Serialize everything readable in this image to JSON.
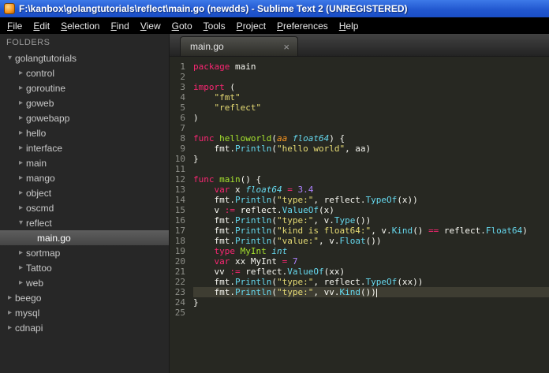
{
  "window": {
    "title": "F:\\kanbox\\golangtutorials\\reflect\\main.go (newdds) - Sublime Text 2 (UNREGISTERED)"
  },
  "menu": {
    "items": [
      "File",
      "Edit",
      "Selection",
      "Find",
      "View",
      "Goto",
      "Tools",
      "Project",
      "Preferences",
      "Help"
    ]
  },
  "sidebar": {
    "header": "FOLDERS",
    "items": [
      {
        "label": "golangtutorials",
        "level": 0,
        "state": "expanded",
        "selected": false
      },
      {
        "label": "control",
        "level": 1,
        "state": "collapsed",
        "selected": false
      },
      {
        "label": "goroutine",
        "level": 1,
        "state": "collapsed",
        "selected": false
      },
      {
        "label": "goweb",
        "level": 1,
        "state": "collapsed",
        "selected": false
      },
      {
        "label": "gowebapp",
        "level": 1,
        "state": "collapsed",
        "selected": false
      },
      {
        "label": "hello",
        "level": 1,
        "state": "collapsed",
        "selected": false
      },
      {
        "label": "interface",
        "level": 1,
        "state": "collapsed",
        "selected": false
      },
      {
        "label": "main",
        "level": 1,
        "state": "collapsed",
        "selected": false
      },
      {
        "label": "mango",
        "level": 1,
        "state": "collapsed",
        "selected": false
      },
      {
        "label": "object",
        "level": 1,
        "state": "collapsed",
        "selected": false
      },
      {
        "label": "oscmd",
        "level": 1,
        "state": "collapsed",
        "selected": false
      },
      {
        "label": "reflect",
        "level": 1,
        "state": "expanded",
        "selected": false
      },
      {
        "label": "main.go",
        "level": 2,
        "state": "file",
        "selected": true
      },
      {
        "label": "sortmap",
        "level": 1,
        "state": "collapsed",
        "selected": false
      },
      {
        "label": "Tattoo",
        "level": 1,
        "state": "collapsed",
        "selected": false
      },
      {
        "label": "web",
        "level": 1,
        "state": "collapsed",
        "selected": false
      },
      {
        "label": "beego",
        "level": 0,
        "state": "collapsed",
        "selected": false
      },
      {
        "label": "mysql",
        "level": 0,
        "state": "collapsed",
        "selected": false
      },
      {
        "label": "cdnapi",
        "level": 0,
        "state": "collapsed",
        "selected": false
      }
    ]
  },
  "tab": {
    "label": "main.go",
    "close_icon": "×"
  },
  "editor": {
    "lines": [
      {
        "n": 1,
        "t": [
          [
            "k",
            "package"
          ],
          [
            "p",
            " main"
          ]
        ]
      },
      {
        "n": 2,
        "t": []
      },
      {
        "n": 3,
        "t": [
          [
            "k",
            "import"
          ],
          [
            "p",
            " ("
          ]
        ]
      },
      {
        "n": 4,
        "t": [
          [
            "p",
            "    "
          ],
          [
            "s",
            "\"fmt\""
          ]
        ]
      },
      {
        "n": 5,
        "t": [
          [
            "p",
            "    "
          ],
          [
            "s",
            "\"reflect\""
          ]
        ]
      },
      {
        "n": 6,
        "t": [
          [
            "p",
            ")"
          ]
        ]
      },
      {
        "n": 7,
        "t": []
      },
      {
        "n": 8,
        "t": [
          [
            "k",
            "func "
          ],
          [
            "f",
            "helloworld"
          ],
          [
            "p",
            "("
          ],
          [
            "a",
            "aa"
          ],
          [
            "p",
            " "
          ],
          [
            "t",
            "float64"
          ],
          [
            "p",
            ") {"
          ]
        ]
      },
      {
        "n": 9,
        "t": [
          [
            "p",
            "    fmt."
          ],
          [
            "c",
            "Println"
          ],
          [
            "p",
            "("
          ],
          [
            "s",
            "\"hello world\""
          ],
          [
            "p",
            ", aa)"
          ]
        ]
      },
      {
        "n": 10,
        "t": [
          [
            "p",
            "}"
          ]
        ]
      },
      {
        "n": 11,
        "t": []
      },
      {
        "n": 12,
        "t": [
          [
            "k",
            "func "
          ],
          [
            "f",
            "main"
          ],
          [
            "p",
            "() {"
          ]
        ]
      },
      {
        "n": 13,
        "t": [
          [
            "p",
            "    "
          ],
          [
            "k",
            "var"
          ],
          [
            "p",
            " x "
          ],
          [
            "t",
            "float64"
          ],
          [
            "p",
            " "
          ],
          [
            "k",
            "="
          ],
          [
            "p",
            " "
          ],
          [
            "n",
            "3.4"
          ]
        ]
      },
      {
        "n": 14,
        "t": [
          [
            "p",
            "    fmt."
          ],
          [
            "c",
            "Println"
          ],
          [
            "p",
            "("
          ],
          [
            "s",
            "\"type:\""
          ],
          [
            "p",
            ", reflect."
          ],
          [
            "c",
            "TypeOf"
          ],
          [
            "p",
            "(x))"
          ]
        ]
      },
      {
        "n": 15,
        "t": [
          [
            "p",
            "    v "
          ],
          [
            "k",
            ":="
          ],
          [
            "p",
            " reflect."
          ],
          [
            "c",
            "ValueOf"
          ],
          [
            "p",
            "(x)"
          ]
        ]
      },
      {
        "n": 16,
        "t": [
          [
            "p",
            "    fmt."
          ],
          [
            "c",
            "Println"
          ],
          [
            "p",
            "("
          ],
          [
            "s",
            "\"type:\""
          ],
          [
            "p",
            ", v."
          ],
          [
            "c",
            "Type"
          ],
          [
            "p",
            "())"
          ]
        ]
      },
      {
        "n": 17,
        "t": [
          [
            "p",
            "    fmt."
          ],
          [
            "c",
            "Println"
          ],
          [
            "p",
            "("
          ],
          [
            "s",
            "\"kind is float64:\""
          ],
          [
            "p",
            ", v."
          ],
          [
            "c",
            "Kind"
          ],
          [
            "p",
            "() "
          ],
          [
            "k",
            "=="
          ],
          [
            "p",
            " reflect."
          ],
          [
            "c",
            "Float64"
          ],
          [
            "p",
            ")"
          ]
        ]
      },
      {
        "n": 18,
        "t": [
          [
            "p",
            "    fmt."
          ],
          [
            "c",
            "Println"
          ],
          [
            "p",
            "("
          ],
          [
            "s",
            "\"value:\""
          ],
          [
            "p",
            ", v."
          ],
          [
            "c",
            "Float"
          ],
          [
            "p",
            "())"
          ]
        ]
      },
      {
        "n": 19,
        "t": [
          [
            "p",
            "    "
          ],
          [
            "k",
            "type"
          ],
          [
            "p",
            " "
          ],
          [
            "f",
            "MyInt"
          ],
          [
            "p",
            " "
          ],
          [
            "t",
            "int"
          ]
        ]
      },
      {
        "n": 20,
        "t": [
          [
            "p",
            "    "
          ],
          [
            "k",
            "var"
          ],
          [
            "p",
            " xx MyInt "
          ],
          [
            "k",
            "="
          ],
          [
            "p",
            " "
          ],
          [
            "n",
            "7"
          ]
        ]
      },
      {
        "n": 21,
        "t": [
          [
            "p",
            "    vv "
          ],
          [
            "k",
            ":="
          ],
          [
            "p",
            " reflect."
          ],
          [
            "c",
            "ValueOf"
          ],
          [
            "p",
            "(xx)"
          ]
        ]
      },
      {
        "n": 22,
        "t": [
          [
            "p",
            "    fmt."
          ],
          [
            "c",
            "Println"
          ],
          [
            "p",
            "("
          ],
          [
            "s",
            "\"type:\""
          ],
          [
            "p",
            ", reflect."
          ],
          [
            "c",
            "TypeOf"
          ],
          [
            "p",
            "(xx))"
          ]
        ]
      },
      {
        "n": 23,
        "t": [
          [
            "p",
            "    fmt."
          ],
          [
            "c",
            "Println"
          ],
          [
            "p",
            "("
          ],
          [
            "s",
            "\"type:\""
          ],
          [
            "p",
            ", vv."
          ],
          [
            "c",
            "Kind"
          ],
          [
            "p",
            "())"
          ]
        ],
        "current": true,
        "cursor": true
      },
      {
        "n": 24,
        "t": [
          [
            "p",
            "}"
          ]
        ]
      },
      {
        "n": 25,
        "t": []
      }
    ]
  },
  "colors": {
    "editor_background": "#272822",
    "keyword": "#f92672",
    "function_name": "#a6e22e",
    "type": "#66d9ef",
    "string": "#e6db74",
    "number": "#ae81ff",
    "call": "#66d9ef",
    "plain_text": "#f8f8f2",
    "line_number": "#8f908a",
    "current_line": "#3e3d32",
    "titlebar_blue": "#2258d0"
  }
}
